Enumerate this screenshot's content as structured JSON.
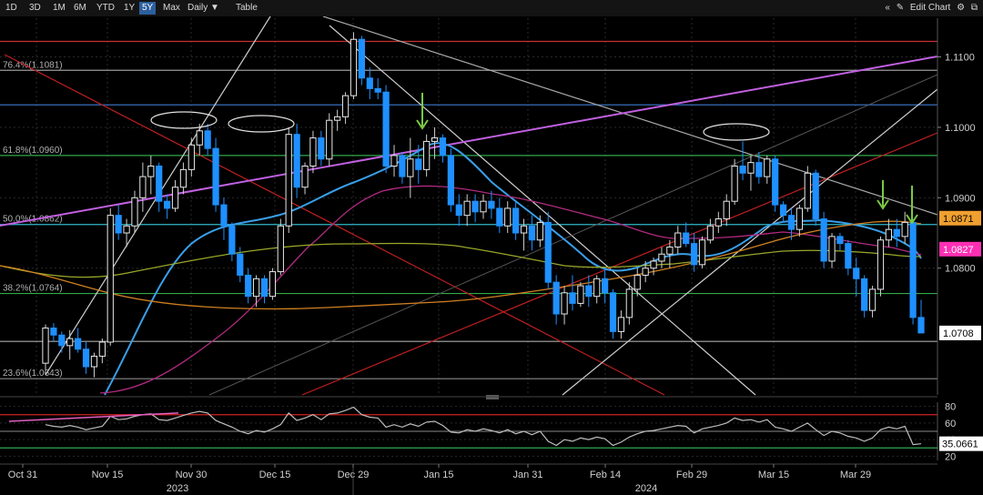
{
  "toolbar": {
    "ranges": [
      "1D",
      "3D",
      "1M",
      "6M",
      "YTD",
      "1Y",
      "5Y",
      "Max"
    ],
    "active_range": "5Y",
    "frequency": "Daily",
    "table_label": "Table",
    "collapse_icon": "double-chevron-left-icon",
    "edit_icon": "pencil-icon",
    "edit_label": "Edit Chart",
    "settings_icon": "gear-icon",
    "widget_icon": "window-icon"
  },
  "chart_data": [
    {
      "type": "candlestick",
      "x_axis": {
        "tick_labels": [
          "Oct 31",
          "Nov 15",
          "Nov 30",
          "Dec 15",
          "Dec 29",
          "Jan 15",
          "Jan 31",
          "Feb 14",
          "Feb 29",
          "Mar 15",
          "Mar 29"
        ],
        "year_labels": [
          "2023",
          "2024"
        ]
      },
      "y_axis": {
        "ticks": [
          "1.0800",
          "1.0900",
          "1.1000",
          "1.1100"
        ],
        "range": [
          1.062,
          1.1155
        ]
      },
      "price_tags": [
        {
          "label": "1.0871",
          "value": 1.0871,
          "color": "#f0a030"
        },
        {
          "label": "1.0827",
          "value": 1.0827,
          "color": "#ff2fb4"
        },
        {
          "label": "1.0708",
          "value": 1.0708,
          "color": "#ffffff"
        }
      ],
      "fib_levels": [
        {
          "label": "76.4%(1.1081)",
          "value": 1.1081,
          "color": "#9a9a9a"
        },
        {
          "label": "61.8%(1.0960)",
          "value": 1.096,
          "color": "#2fa84a"
        },
        {
          "label": "50.0%(1.0862)",
          "value": 1.0862,
          "color": "#2fb7c8"
        },
        {
          "label": "38.2%(1.0764)",
          "value": 1.0764,
          "color": "#2fa84a"
        },
        {
          "label": "23.6%(1.0643)",
          "value": 1.0643,
          "color": "#888888"
        }
      ],
      "horizontal_lines": [
        {
          "value": 1.1122,
          "color": "#c83030"
        },
        {
          "value": 1.1032,
          "color": "#3a7ad0"
        },
        {
          "value": 1.0696,
          "color": "#aaaaaa"
        }
      ],
      "candles": [
        [
          1.0665,
          1.072,
          1.0655,
          1.0715
        ],
        [
          1.0715,
          1.0722,
          1.0695,
          1.0705
        ],
        [
          1.0705,
          1.071,
          1.068,
          1.069
        ],
        [
          1.069,
          1.0712,
          1.067,
          1.07
        ],
        [
          1.07,
          1.0715,
          1.068,
          1.0685
        ],
        [
          1.0685,
          1.0695,
          1.065,
          1.066
        ],
        [
          1.066,
          1.068,
          1.0645,
          1.0675
        ],
        [
          1.0675,
          1.07,
          1.0665,
          1.0695
        ],
        [
          1.0695,
          1.0885,
          1.069,
          1.0875
        ],
        [
          1.0875,
          1.089,
          1.084,
          1.085
        ],
        [
          1.085,
          1.087,
          1.083,
          1.086
        ],
        [
          1.086,
          1.091,
          1.085,
          1.09
        ],
        [
          1.09,
          1.095,
          1.088,
          1.093
        ],
        [
          1.093,
          1.096,
          1.0905,
          1.0945
        ],
        [
          1.0945,
          1.095,
          1.088,
          1.0895
        ],
        [
          1.0895,
          1.0905,
          1.087,
          1.0885
        ],
        [
          1.0885,
          1.0925,
          1.088,
          1.0915
        ],
        [
          1.0915,
          1.095,
          1.0905,
          1.094
        ],
        [
          1.094,
          1.0985,
          1.093,
          1.0975
        ],
        [
          1.0975,
          1.1005,
          1.096,
          1.0995
        ],
        [
          1.0995,
          1.1005,
          1.096,
          1.097
        ],
        [
          1.097,
          1.0985,
          1.088,
          1.089
        ],
        [
          1.089,
          1.09,
          1.084,
          1.086
        ],
        [
          1.086,
          1.0865,
          1.081,
          1.082
        ],
        [
          1.082,
          1.083,
          1.078,
          1.079
        ],
        [
          1.079,
          1.08,
          1.075,
          1.076
        ],
        [
          1.076,
          1.079,
          1.0745,
          1.0785
        ],
        [
          1.0785,
          1.079,
          1.075,
          1.076
        ],
        [
          1.076,
          1.08,
          1.0755,
          1.0795
        ],
        [
          1.0795,
          1.087,
          1.079,
          1.086
        ],
        [
          1.086,
          1.1,
          1.085,
          1.099
        ],
        [
          1.099,
          1.1005,
          1.09,
          1.0915
        ],
        [
          1.0915,
          1.095,
          1.0905,
          1.0945
        ],
        [
          1.0945,
          1.0995,
          1.0935,
          1.0985
        ],
        [
          1.0985,
          1.0995,
          1.0945,
          1.0955
        ],
        [
          1.0955,
          1.102,
          1.0945,
          1.101
        ],
        [
          1.101,
          1.1025,
          1.0995,
          1.1015
        ],
        [
          1.1015,
          1.105,
          1.1005,
          1.1045
        ],
        [
          1.1045,
          1.1135,
          1.104,
          1.1125
        ],
        [
          1.1125,
          1.113,
          1.106,
          1.107
        ],
        [
          1.107,
          1.1085,
          1.104,
          1.1055
        ],
        [
          1.1055,
          1.107,
          1.104,
          1.105
        ],
        [
          1.105,
          1.106,
          1.0935,
          1.0945
        ],
        [
          1.0945,
          1.0975,
          1.093,
          1.096
        ],
        [
          1.096,
          1.0965,
          1.092,
          1.093
        ],
        [
          1.093,
          1.0985,
          1.09,
          1.0955
        ],
        [
          1.0955,
          1.0975,
          1.092,
          1.094
        ],
        [
          1.094,
          1.099,
          1.093,
          1.098
        ],
        [
          1.098,
          1.1,
          1.0955,
          1.0985
        ],
        [
          1.0985,
          1.099,
          1.095,
          1.096
        ],
        [
          1.096,
          1.097,
          1.088,
          1.089
        ],
        [
          1.089,
          1.0905,
          1.086,
          1.0875
        ],
        [
          1.0875,
          1.0905,
          1.086,
          1.0895
        ],
        [
          1.0895,
          1.0905,
          1.0865,
          1.088
        ],
        [
          1.088,
          1.0905,
          1.087,
          1.0895
        ],
        [
          1.0895,
          1.091,
          1.087,
          1.0885
        ],
        [
          1.0885,
          1.09,
          1.085,
          1.086
        ],
        [
          1.086,
          1.0895,
          1.085,
          1.0885
        ],
        [
          1.0885,
          1.0895,
          1.084,
          1.085
        ],
        [
          1.085,
          1.087,
          1.0825,
          1.086
        ],
        [
          1.086,
          1.0875,
          1.0825,
          1.084
        ],
        [
          1.084,
          1.0875,
          1.083,
          1.0865
        ],
        [
          1.0865,
          1.088,
          1.077,
          1.078
        ],
        [
          1.078,
          1.079,
          1.072,
          1.0735
        ],
        [
          1.0735,
          1.0775,
          1.072,
          1.0765
        ],
        [
          1.0765,
          1.079,
          1.074,
          1.075
        ],
        [
          1.075,
          1.078,
          1.0745,
          1.0775
        ],
        [
          1.0775,
          1.079,
          1.0745,
          1.076
        ],
        [
          1.076,
          1.079,
          1.075,
          1.0785
        ],
        [
          1.0785,
          1.08,
          1.075,
          1.0765
        ],
        [
          1.0765,
          1.077,
          1.07,
          1.071
        ],
        [
          1.071,
          1.074,
          1.07,
          1.073
        ],
        [
          1.073,
          1.078,
          1.072,
          1.077
        ],
        [
          1.077,
          1.08,
          1.076,
          1.079
        ],
        [
          1.079,
          1.081,
          1.078,
          1.08
        ],
        [
          1.08,
          1.0815,
          1.079,
          1.081
        ],
        [
          1.081,
          1.083,
          1.08,
          1.082
        ],
        [
          1.082,
          1.084,
          1.08,
          1.083
        ],
        [
          1.083,
          1.086,
          1.082,
          1.085
        ],
        [
          1.085,
          1.0865,
          1.083,
          1.0835
        ],
        [
          1.0835,
          1.085,
          1.0795,
          1.0805
        ],
        [
          1.0805,
          1.0845,
          1.08,
          1.084
        ],
        [
          1.084,
          1.087,
          1.0835,
          1.086
        ],
        [
          1.086,
          1.088,
          1.085,
          1.087
        ],
        [
          1.087,
          1.0905,
          1.086,
          1.0895
        ],
        [
          1.0895,
          1.0955,
          1.089,
          1.0945
        ],
        [
          1.0945,
          1.098,
          1.0925,
          1.0935
        ],
        [
          1.0935,
          1.096,
          1.091,
          1.095
        ],
        [
          1.095,
          1.0965,
          1.092,
          1.093
        ],
        [
          1.093,
          1.096,
          1.092,
          1.0955
        ],
        [
          1.0955,
          1.096,
          1.088,
          1.089
        ],
        [
          1.089,
          1.0895,
          1.0865,
          1.0875
        ],
        [
          1.0875,
          1.0885,
          1.084,
          1.0855
        ],
        [
          1.0855,
          1.089,
          1.0845,
          1.0885
        ],
        [
          1.0885,
          1.0945,
          1.088,
          1.0935
        ],
        [
          1.0935,
          1.094,
          1.086,
          1.087
        ],
        [
          1.087,
          1.088,
          1.08,
          1.081
        ],
        [
          1.081,
          1.085,
          1.08,
          1.0845
        ],
        [
          1.0845,
          1.085,
          1.0825,
          1.0835
        ],
        [
          1.0835,
          1.084,
          1.079,
          1.08
        ],
        [
          1.08,
          1.0815,
          1.076,
          1.0785
        ],
        [
          1.0785,
          1.079,
          1.073,
          1.074
        ],
        [
          1.074,
          1.0775,
          1.073,
          1.077
        ],
        [
          1.077,
          1.0845,
          1.076,
          1.084
        ],
        [
          1.084,
          1.087,
          1.083,
          1.0855
        ],
        [
          1.0855,
          1.087,
          1.083,
          1.0845
        ],
        [
          1.0845,
          1.088,
          1.0835,
          1.0865
        ],
        [
          1.0865,
          1.087,
          1.072,
          1.073
        ],
        [
          1.073,
          1.0755,
          1.071,
          1.0708
        ]
      ],
      "annotations": {
        "arrows_down": 3,
        "ellipses": 3
      }
    },
    {
      "type": "line",
      "y_axis": {
        "ticks": [
          "80",
          "60",
          "40",
          "20"
        ],
        "range": [
          15,
          85
        ]
      },
      "value_tag": {
        "label": "35.0661",
        "value": 35.0661
      },
      "levels": [
        {
          "value": 70,
          "color": "#d02020"
        },
        {
          "value": 30,
          "color": "#2fa84a"
        }
      ],
      "series_values": [
        58,
        56,
        55,
        57,
        55,
        52,
        54,
        56,
        68,
        64,
        65,
        68,
        70,
        71,
        64,
        63,
        66,
        69,
        72,
        74,
        72,
        63,
        59,
        55,
        50,
        47,
        51,
        49,
        53,
        58,
        72,
        63,
        66,
        70,
        64,
        71,
        72,
        75,
        79,
        70,
        67,
        66,
        55,
        58,
        55,
        59,
        56,
        61,
        62,
        57,
        49,
        48,
        52,
        50,
        53,
        51,
        48,
        52,
        47,
        50,
        46,
        50,
        38,
        33,
        40,
        38,
        42,
        40,
        43,
        41,
        33,
        37,
        43,
        47,
        50,
        51,
        53,
        55,
        57,
        56,
        48,
        53,
        55,
        57,
        60,
        66,
        63,
        64,
        61,
        64,
        55,
        53,
        50,
        55,
        60,
        52,
        45,
        50,
        48,
        44,
        42,
        38,
        42,
        52,
        55,
        53,
        56,
        34,
        35
      ]
    }
  ]
}
